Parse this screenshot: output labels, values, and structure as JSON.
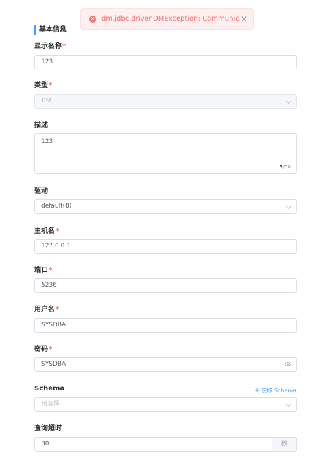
{
  "toast": {
    "message": "dm.jdbc.driver.DMException:  Communication  error",
    "close": "✕"
  },
  "section": {
    "title": "基本信息"
  },
  "fields": {
    "display_name": {
      "label": "显示名称",
      "required": "*",
      "value": "123"
    },
    "type": {
      "label": "类型",
      "required": "*",
      "value": "DM"
    },
    "description": {
      "label": "描述",
      "value": "123",
      "count": "3",
      "max": "/50"
    },
    "driver": {
      "label": "驱动",
      "value": "default(8)"
    },
    "host": {
      "label": "主机名",
      "required": "*",
      "value": "127.0.0.1"
    },
    "port": {
      "label": "端口",
      "required": "*",
      "value": "5236"
    },
    "username": {
      "label": "用户名",
      "required": "*",
      "value": "SYSDBA"
    },
    "password": {
      "label": "密码",
      "required": "*",
      "value": "SYSDBA"
    },
    "schema": {
      "label": "Schema",
      "placeholder": "请选择",
      "fetch_label": "获取 Schema",
      "fetch_icon": "+"
    },
    "timeout": {
      "label": "查询超时",
      "value": "30",
      "unit": "秒"
    }
  },
  "colors": {
    "accent": "#409eff",
    "danger": "#f56c6c"
  }
}
